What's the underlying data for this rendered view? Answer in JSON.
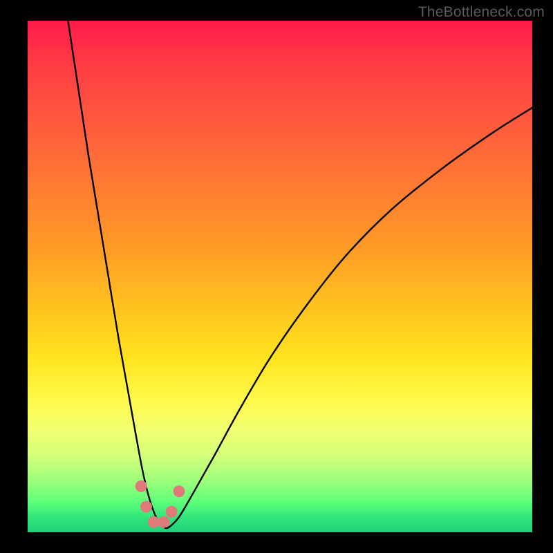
{
  "watermark": "TheBottleneck.com",
  "chart_data": {
    "type": "line",
    "title": "",
    "xlabel": "",
    "ylabel": "",
    "xlim": [
      0,
      100
    ],
    "ylim": [
      0,
      100
    ],
    "series": [
      {
        "name": "bottleneck-curve",
        "x": [
          8,
          10,
          12,
          14,
          16,
          18,
          20,
          22,
          23,
          24,
          25,
          26,
          27,
          28,
          30,
          33,
          37,
          42,
          48,
          55,
          63,
          72,
          82,
          92,
          100
        ],
        "y": [
          100,
          87,
          74,
          62,
          50,
          38,
          27,
          16,
          11,
          7,
          4,
          2,
          1,
          1,
          3,
          8,
          15,
          24,
          34,
          44,
          54,
          63,
          71,
          78,
          83
        ]
      }
    ],
    "markers": {
      "name": "near-optimum-dots",
      "color": "#e07a7a",
      "points": [
        {
          "x": 22.5,
          "y": 9
        },
        {
          "x": 23.5,
          "y": 5
        },
        {
          "x": 25.0,
          "y": 2
        },
        {
          "x": 27.0,
          "y": 2
        },
        {
          "x": 28.5,
          "y": 4
        },
        {
          "x": 30.0,
          "y": 8
        }
      ]
    },
    "bottom_band": {
      "name": "optimum-band",
      "color_top": "#ffff8a",
      "color_bottom": "#1fcf7a",
      "y_range": [
        0,
        12
      ]
    }
  }
}
